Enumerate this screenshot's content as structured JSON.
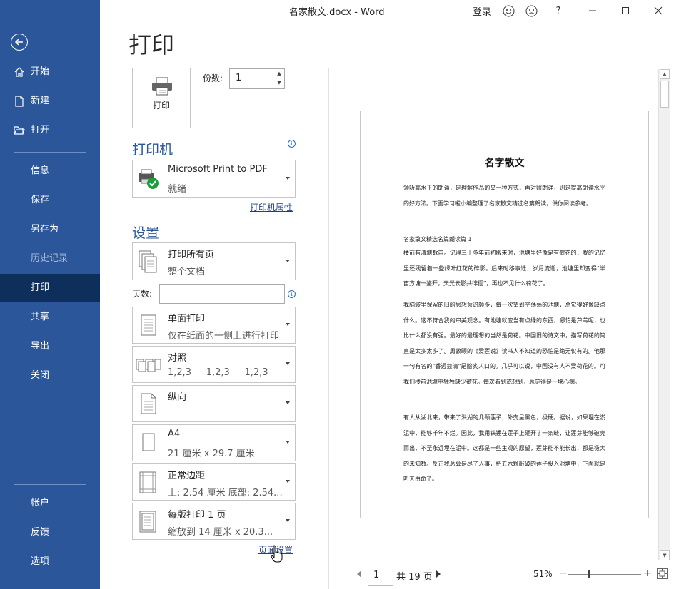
{
  "titlebar": {
    "title": "名家散文.docx  -  Word",
    "login": "登录",
    "help": "?"
  },
  "sidebar": {
    "items": [
      {
        "label": "开始"
      },
      {
        "label": "新建"
      },
      {
        "label": "打开"
      },
      {
        "label": "信息"
      },
      {
        "label": "保存"
      },
      {
        "label": "另存为"
      },
      {
        "label": "历史记录"
      },
      {
        "label": "打印"
      },
      {
        "label": "共享"
      },
      {
        "label": "导出"
      },
      {
        "label": "关闭"
      },
      {
        "label": "帐户"
      },
      {
        "label": "反馈"
      },
      {
        "label": "选项"
      }
    ],
    "active": "打印",
    "disabled": "历史记录"
  },
  "page_title": "打印",
  "print_button_label": "打印",
  "copies": {
    "label": "份数:",
    "value": "1"
  },
  "printer": {
    "heading": "打印机",
    "name": "Microsoft Print to PDF",
    "status": "就绪",
    "properties_link": "打印机属性"
  },
  "settings": {
    "heading": "设置",
    "range": {
      "title": "打印所有页",
      "subtitle": "整个文档"
    },
    "pages_label": "页数:",
    "pages_value": "",
    "sides": {
      "title": "单面打印",
      "subtitle": "仅在纸面的一侧上进行打印"
    },
    "collate": {
      "title": "对照",
      "subtitle": "1,2,3     1,2,3     1,2,3"
    },
    "orientation": {
      "title": "纵向"
    },
    "paper": {
      "title": "A4",
      "subtitle": "21 厘米 x 29.7 厘米"
    },
    "margins": {
      "title": "正常边距",
      "subtitle": "上: 2.54 厘米 底部: 2.54..."
    },
    "pages_per_sheet": {
      "title": "每版打印 1 页",
      "subtitle": "缩放到 14 厘米 x 20.3..."
    },
    "page_setup_link": "页面设置"
  },
  "preview": {
    "doc_title": "名字散文",
    "para1": "领听高水平的朗诵，是理解作品的又一种方式，再对照朗诵，则是提高朗读水平的好方法。下面学习啦小编整理了名家散文精选名篇朗读，供你阅读参考。",
    "subheading": "名家散文精选名篇朗读篇 1",
    "para2": "楼前有清塘数亩。记得三十多年前初搬来时，池塘里好像是有荷花的，我的记忆里还残留着一些绿叶红花的碎影。后来时移事迁，岁月流逝，池塘里却变得\"半亩方塘一鉴开，天光云影共徘徊\"，再也不见什么荷花了。",
    "para3": "我脑袋里保留的旧的思想意识颇多，每一次望到空荡荡的池塘，总觉得好像缺点什么。这不符合我的审美观念。有池塘就应当有点绿的东西，哪怕是芦苇呢，也比什么都没有强。最好的最理想的当然是荷花。中国旧的诗文中，描写荷花的简直是太多太多了。周敦颐的《爱莲说》读书人不知道的恐怕是绝无仅有的。他那一句有名的\"香远益清\"是脍炙人口的。几乎可以说，中国没有人不爱荷花的。可我们楼前池塘中独独缺少荷花。每次看到或想到，总觉得是一块心病。",
    "para4": "有人从湖北来，带来了洪湖的几颗莲子，外壳呈黑色，极硬。据说，如果埋在淤泥中，能够千年不烂。因此，我用铁锤在莲子上砸开了一条缝，让莲芽能够破壳而出，不至永远埋在泥中。这都是一些主观的愿望，莲芽能不能长出，都是极大的未知数。反正我总算是尽了人事，把五六颗敲破的莲子投入池塘中，下面就是听天由命了。"
  },
  "nav": {
    "current_page": "1",
    "total": "共 19 页",
    "zoom": "51%",
    "zoom_fraction": 0.27,
    "zoom_out": "−",
    "zoom_in": "+"
  },
  "colors": {
    "sidebar": "#2b579a",
    "sidebar_active": "#0e2f5c",
    "accent": "#2b579a",
    "link": "#1f3f86",
    "status_ok": "#1e9e3a"
  }
}
